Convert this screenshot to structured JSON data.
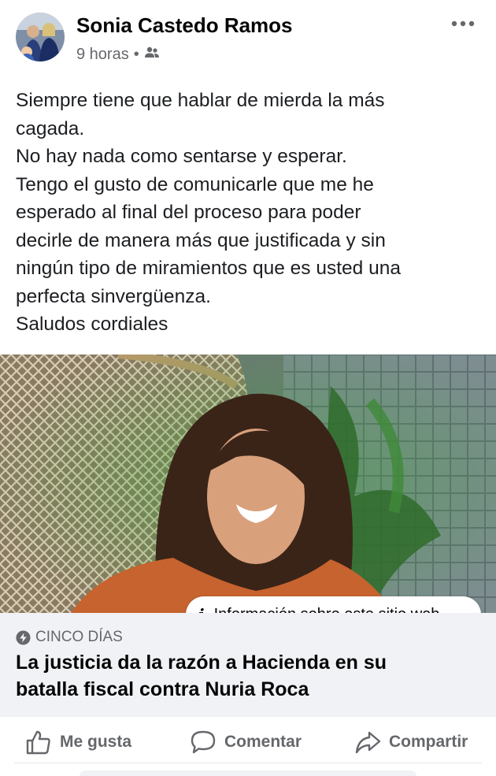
{
  "post": {
    "author": "Sonia Castedo Ramos",
    "time": "9 horas",
    "separator": "•",
    "audience_icon": "friends-icon",
    "more_icon": "more-horizontal-icon",
    "text_lines": [
      "Siempre tiene que hablar de mierda la más",
      "cagada.",
      "No hay nada como sentarse y esperar.",
      "Tengo el gusto de comunicarle que me he",
      "esperado al final del proceso para poder",
      "decirle de manera más que justificada y sin",
      "ningún tipo de miramientos  que es usted una",
      "perfecta sinvergüenza.",
      "Saludos cordiales"
    ]
  },
  "link": {
    "info_label": "Información sobre este sitio web",
    "info_icon": "info-icon",
    "source": "CINCO DÍAS",
    "source_icon": "lightning-bolt-icon",
    "headline_lines": [
      "La justicia da la razón a Hacienda en su",
      "batalla fiscal contra Nuria Roca"
    ]
  },
  "actions": {
    "like": "Me gusta",
    "comment": "Comentar",
    "share": "Compartir"
  },
  "colors": {
    "text_primary": "#050505",
    "text_secondary": "#65676b",
    "card_background": "#f0f2f5"
  }
}
